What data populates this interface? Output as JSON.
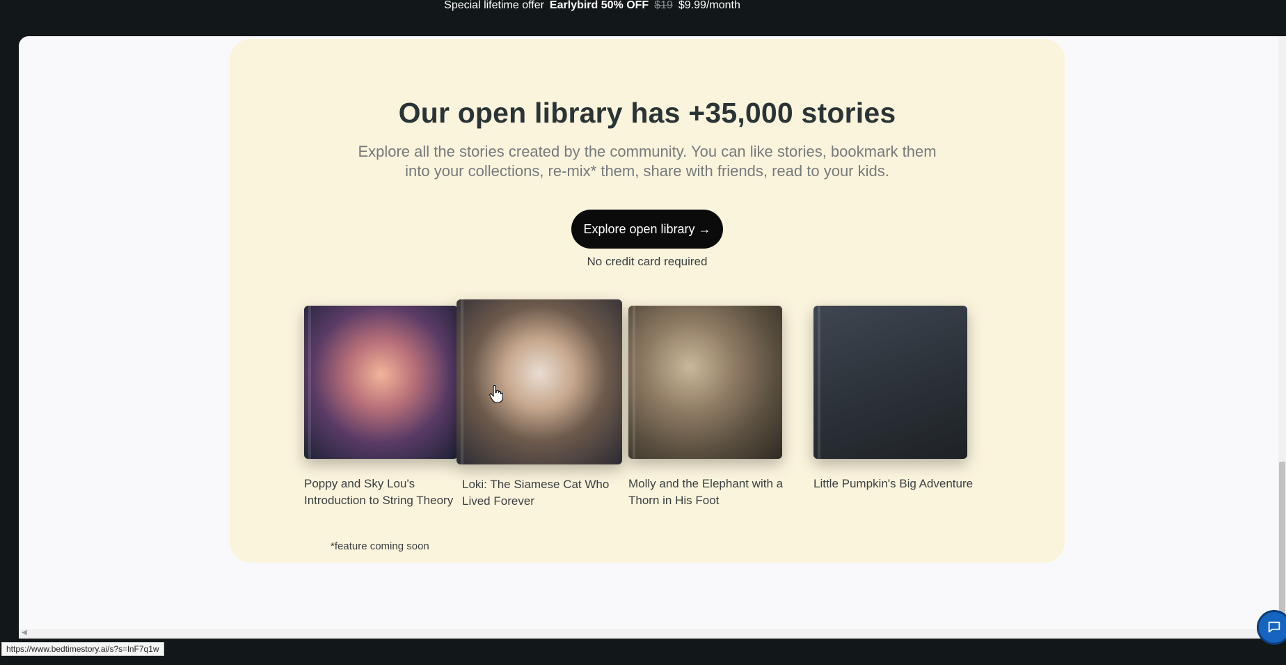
{
  "promo": {
    "label": "Special lifetime offer",
    "discount": "Earlybird 50% OFF",
    "old_price": "$19",
    "new_price": "$9.99/month"
  },
  "library": {
    "headline": "Our open library has +35,000 stories",
    "subtitle": "Explore all the stories created by the community. You can like stories, bookmark them into your collections, re-mix* them, share with friends, read to your kids.",
    "cta_label": "Explore open library →",
    "cta_note": "No credit card required",
    "footnote": "*feature coming soon",
    "stories": [
      {
        "title": "Poppy and Sky Lou's Introduction to String Theory"
      },
      {
        "title": "Loki: The Siamese Cat Who Lived Forever"
      },
      {
        "title": "Molly and the Elephant with a Thorn in His Foot"
      },
      {
        "title": "Little Pumpkin's Big Adventure"
      }
    ]
  },
  "status_bar": {
    "url": "https://www.bedtimestory.ai/s?s=lnF7q1w"
  },
  "icons": {
    "chat": "chat-bubble-icon",
    "cursor": "hand-pointer-icon"
  }
}
